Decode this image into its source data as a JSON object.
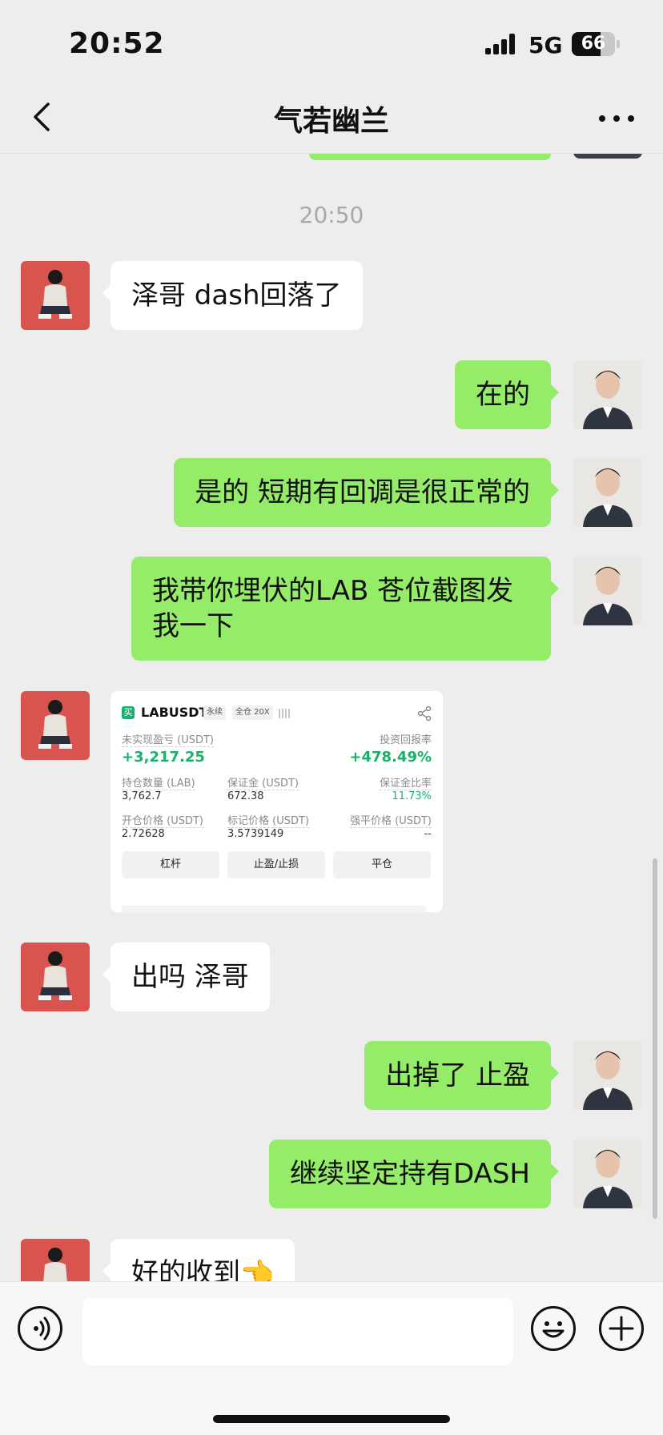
{
  "status_bar": {
    "time": "20:52",
    "network": "5G",
    "battery": "66",
    "battery_level": 0.66
  },
  "header": {
    "title": "气若幽兰"
  },
  "chat": {
    "timestamp": "20:50",
    "messages": [
      {
        "side": "left",
        "text": "泽哥 dash回落了"
      },
      {
        "side": "right",
        "text": "在的"
      },
      {
        "side": "right",
        "text": "是的 短期有回调是很正常的"
      },
      {
        "side": "right",
        "text": "我带你埋伏的LAB 苍位截图发我一下"
      },
      {
        "side": "left",
        "type": "image"
      },
      {
        "side": "left",
        "text": "出吗 泽哥"
      },
      {
        "side": "right",
        "text": "出掉了 止盈"
      },
      {
        "side": "right",
        "text": "继续坚定持有DASH"
      },
      {
        "side": "left",
        "text": "好的收到👈"
      }
    ]
  },
  "trade_card": {
    "side_badge": "买",
    "symbol": "LABUSDT",
    "type_tag": "永续",
    "margin_tag": "全仓 20X",
    "pnl_label": "未实现盈亏 (USDT)",
    "pnl_value": "+3,217.25",
    "roi_label": "投资回报率",
    "roi_value": "+478.49%",
    "position_label": "持仓数量 (LAB)",
    "position_value": "3,762.7",
    "margin_label": "保证金 (USDT)",
    "margin_value": "672.38",
    "margin_ratio_label": "保证金比率",
    "margin_ratio_value": "11.73%",
    "entry_label": "开仓价格 (USDT)",
    "entry_value": "2.72628",
    "mark_label": "标记价格 (USDT)",
    "mark_value": "3.5739149",
    "liq_label": "强平价格 (USDT)",
    "liq_value": "--",
    "buttons": [
      "杠杆",
      "止盈/止损",
      "平仓"
    ],
    "accent_color": "#17b26a"
  },
  "icons": {
    "back": "chevron-left-icon",
    "more": "more-dots-icon",
    "voice": "voice-icon",
    "emoji": "emoji-icon",
    "plus": "plus-icon",
    "share": "share-icon"
  },
  "colors": {
    "my_bubble": "#95ec69",
    "their_bubble": "#ffffff",
    "background": "#ededed"
  }
}
